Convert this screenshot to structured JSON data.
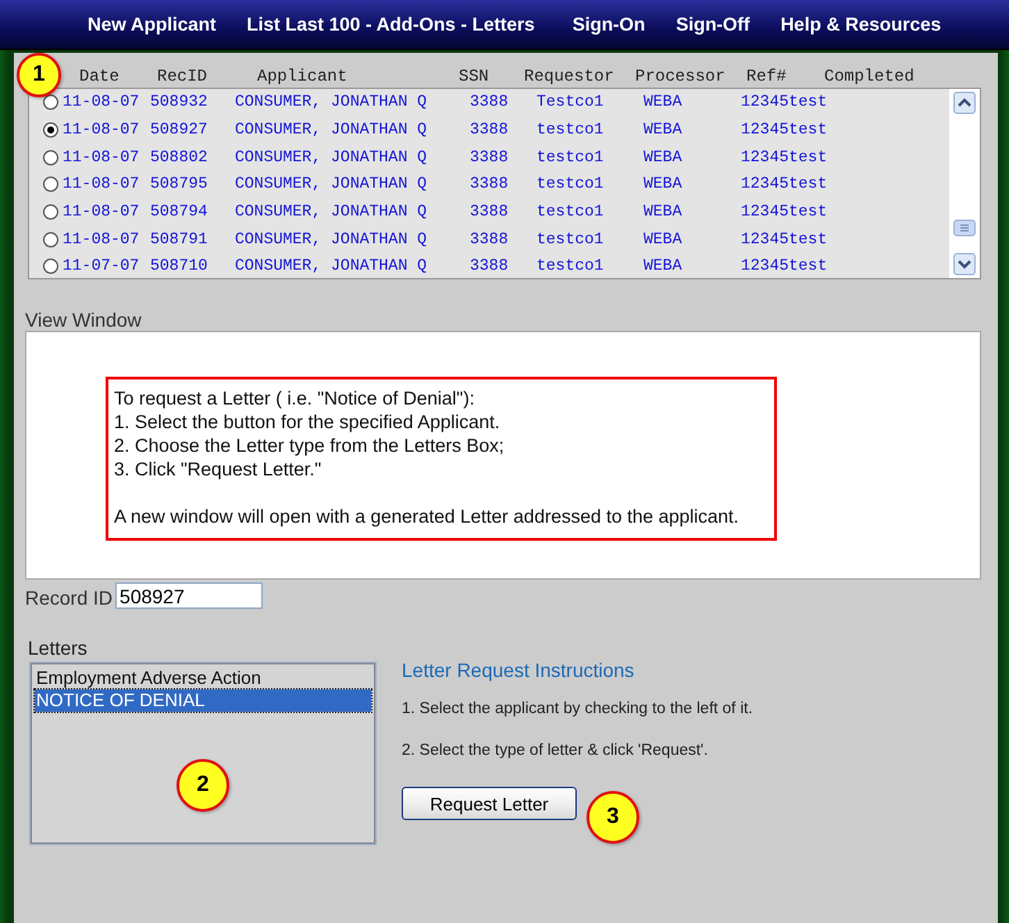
{
  "nav": [
    "New Applicant",
    "List Last 100 - Add-Ons - Letters",
    "Sign-On",
    "Sign-Off",
    "Help & Resources"
  ],
  "table": {
    "columns": [
      "Date",
      "RecID",
      "Applicant",
      "SSN",
      "Requestor",
      "Processor",
      "Ref#",
      "Completed"
    ],
    "rows": [
      {
        "selected": false,
        "cells": [
          "11-08-07",
          "508932",
          "CONSUMER, JONATHAN Q",
          "3388",
          "Testco1",
          "WEBA",
          "12345test"
        ]
      },
      {
        "selected": true,
        "cells": [
          "11-08-07",
          "508927",
          "CONSUMER, JONATHAN Q",
          "3388",
          "testco1",
          "WEBA",
          "12345test"
        ]
      },
      {
        "selected": false,
        "cells": [
          "11-08-07",
          "508802",
          "CONSUMER, JONATHAN Q",
          "3388",
          "testco1",
          "WEBA",
          "12345test"
        ]
      },
      {
        "selected": false,
        "cells": [
          "11-08-07",
          "508795",
          "CONSUMER, JONATHAN Q",
          "3388",
          "testco1",
          "WEBA",
          "12345test"
        ]
      },
      {
        "selected": false,
        "cells": [
          "11-08-07",
          "508794",
          "CONSUMER, JONATHAN Q",
          "3388",
          "testco1",
          "WEBA",
          "12345test"
        ]
      },
      {
        "selected": false,
        "cells": [
          "11-08-07",
          "508791",
          "CONSUMER, JONATHAN Q",
          "3388",
          "testco1",
          "WEBA",
          "12345test"
        ]
      },
      {
        "selected": false,
        "cells": [
          "11-07-07",
          "508710",
          "CONSUMER, JONATHAN Q",
          "3388",
          "testco1",
          "WEBA",
          "12345test"
        ]
      }
    ]
  },
  "view_window": {
    "label": "View Window",
    "lines": [
      "To request a Letter ( i.e. \"Notice of Denial\"):",
      "1. Select the button for the specified Applicant.",
      "2. Choose the Letter type from the Letters Box;",
      "3. Click \"Request Letter.\""
    ],
    "note": "A new window will open with a generated Letter addressed to the applicant."
  },
  "record_id": {
    "label": "Record ID",
    "value": "508927"
  },
  "letters": {
    "label": "Letters",
    "items": [
      {
        "label": "Employment Adverse Action",
        "selected": false
      },
      {
        "label": "NOTICE OF DENIAL",
        "selected": true
      }
    ]
  },
  "instructions": {
    "title": "Letter Request Instructions",
    "steps": [
      "1. Select the applicant by checking to the left of it.",
      "2. Select the type of letter & click 'Request'."
    ]
  },
  "request_button": "Request Letter",
  "callouts": [
    "1",
    "2",
    "3"
  ]
}
